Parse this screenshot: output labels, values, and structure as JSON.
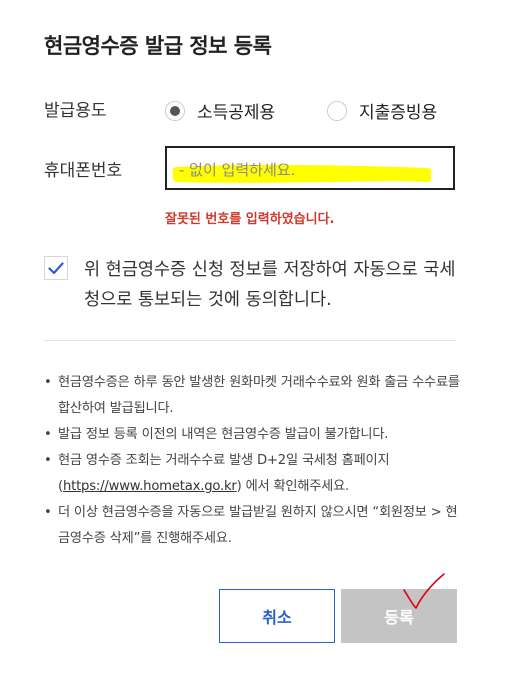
{
  "dialog": {
    "title": "현금영수증 발급 정보 등록",
    "usage_label": "발급용도",
    "usage_options": [
      {
        "label": "소득공제용",
        "selected": true
      },
      {
        "label": "지출증빙용",
        "selected": false
      }
    ],
    "phone_label": "휴대폰번호",
    "phone_placeholder": "- 없이 입력하세요.",
    "phone_value": "",
    "error_text": "잘못된 번호를 입력하였습니다.",
    "consent_checked": true,
    "consent_text": "위 현금영수증 신청 정보를 저장하여 자동으로 국세청으로 통보되는 것에 동의합니다.",
    "notices": [
      {
        "bullet": "•",
        "text": "현금영수증은 하루 동안 발생한 원화마켓 거래수수료와 원화 출금 수수료를 합산하여 발급됩니다."
      },
      {
        "bullet": "•",
        "text": "발급 정보 등록 이전의 내역은 현금영수증 발급이 불가합니다."
      },
      {
        "bullet": "•",
        "text_before": "현금 영수증 조회는 거래수수료 발생 D+2일 국세청 홈페이지 (",
        "link": "https://www.hometax.go.kr",
        "text_after": ") 에서 확인해주세요."
      },
      {
        "bullet": "•",
        "text": "더 이상 현금영수증을 자동으로 발급받길 원하지 않으시면 “회원정보 > 현금영수증 삭제”를 진행해주세요."
      }
    ],
    "cancel_label": "취소",
    "submit_label": "등록",
    "colors": {
      "accent": "#2b5fd0",
      "error": "#d0392b",
      "disabled_button": "#c4c4c4",
      "highlight_scribble": "#ffff00",
      "check_scribble": "#e0001b"
    }
  }
}
